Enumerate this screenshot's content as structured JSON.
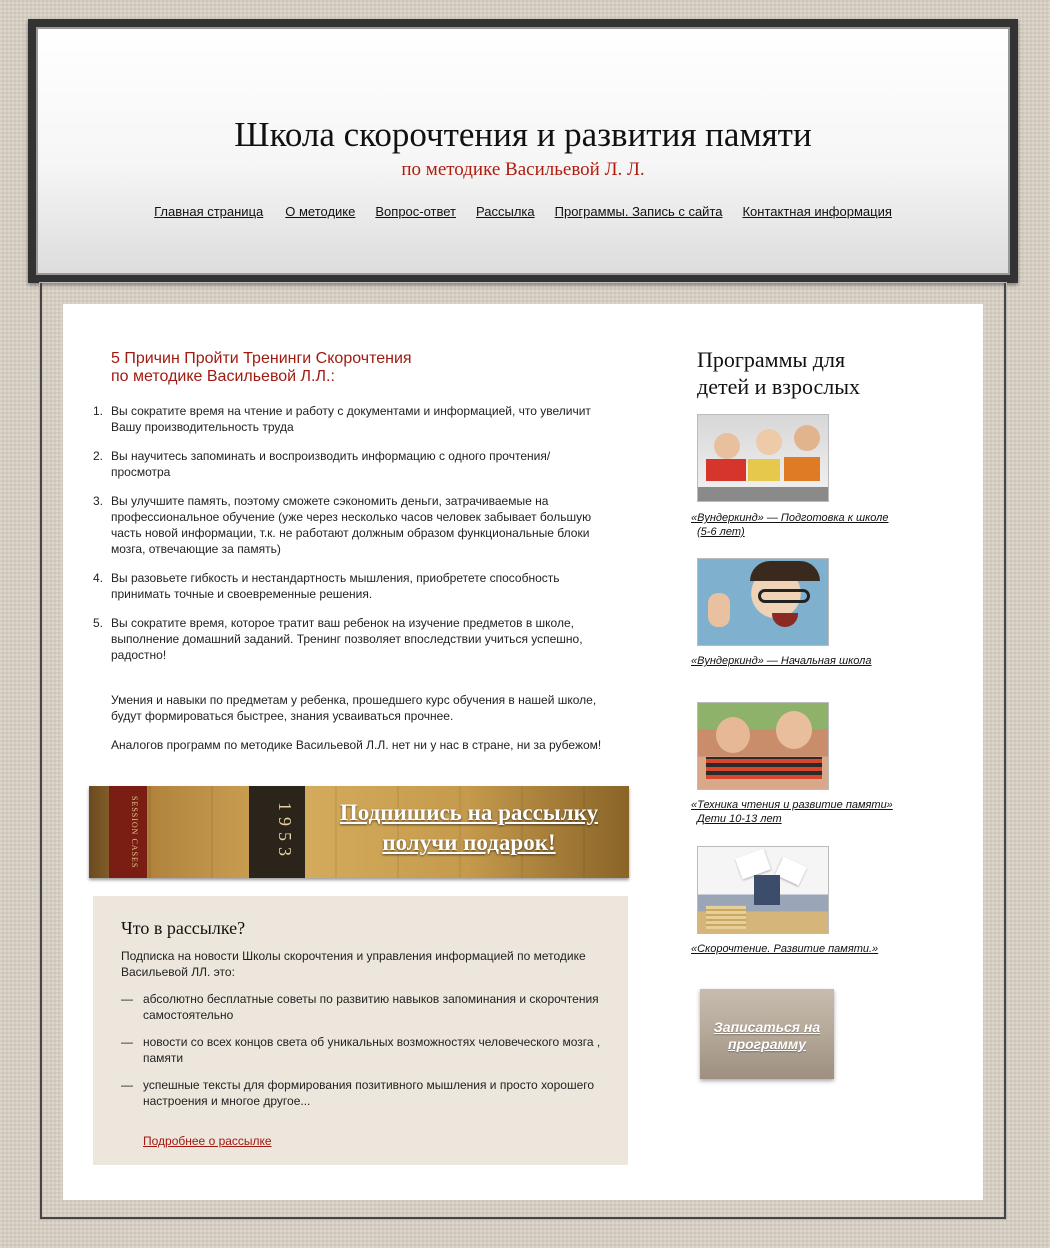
{
  "header": {
    "title": "Школа скорочтения и развития памяти",
    "subtitle": "по методике Васильевой Л. Л.",
    "nav": [
      "Главная страница",
      "О методике",
      "Вопрос-ответ",
      "Рассылка",
      "Программы. Запись с сайта",
      "Контактная информация"
    ]
  },
  "main": {
    "reasons_title_line1": "5 Причин Пройти Тренинги Скорочтения",
    "reasons_title_line2": "по методике Васильевой Л.Л.:",
    "reasons": [
      {
        "num": "1.",
        "text": "Вы сократите время на чтение и работу с документами и информацией, что увеличит Вашу производительность труда"
      },
      {
        "num": "2.",
        "text": "Вы научитесь запоминать и воспроизводить информацию с одного прочтения/просмотра"
      },
      {
        "num": "3.",
        "text": "Вы улучшите память, поэтому сможете сэкономить деньги, затрачиваемые на профессиональное обучение (уже через несколько часов человек забывает большую часть новой информации, т.к. не работают должным образом функциональные блоки мозга, отвечающие за память)"
      },
      {
        "num": "4.",
        "text": "Вы разовьете гибкость и нестандартность мышления, приобретете способность принимать точные и своевременные решения."
      },
      {
        "num": "5.",
        "text": "Вы сократите время, которое тратит ваш ребенок на изучение предметов в школе, выполнение домашний заданий. Тренинг позволяет впоследствии учиться успешно, радостно!"
      }
    ],
    "para1": "Умения и навыки по предметам у ребенка, прошедшего курс обучения в нашей школе, будут формироваться быстрее, знания усваиваться прочнее.",
    "para2": "Аналогов программ по методике Васильевой Л.Л. нет ни у нас в стране, ни за рубежом!",
    "banner": {
      "spine_text": "SESSION CASES",
      "spine_year": "1953",
      "line1": "Подпишись на рассылку",
      "line2": "получи подарок!"
    },
    "newsletter": {
      "title": "Что в рассылке?",
      "intro": "Подписка на новости Школы скорочтения и управления информацией по методике Васильевой ЛЛ. это:",
      "items": [
        "абсолютно бесплатные советы по развитию навыков запоминания и скорочтения самостоятельно",
        "новости со всех концов света об уникальных возможностях человеческого мозга , памяти",
        "успешные тексты для формирования позитивного мышления и просто хорошего настроения и многое другое..."
      ],
      "dash": "—",
      "more_link": "Подробнее о рассылке"
    }
  },
  "sidebar": {
    "title_line1": "Программы для",
    "title_line2": "детей и взрослых",
    "programs": [
      {
        "line1": "«Вундеркинд» — Подготовка к школе",
        "line2": "(5-6 лет)"
      },
      {
        "line1": "«Вундеркинд» — Начальная школа",
        "line2": ""
      },
      {
        "line1": "«Техника чтения и развитие памяти»",
        "line2": "Дети 10-13 лет"
      },
      {
        "line1": "«Скорочтение. Развитие памяти.»",
        "line2": ""
      }
    ],
    "signup_label": "Записаться на программу"
  }
}
